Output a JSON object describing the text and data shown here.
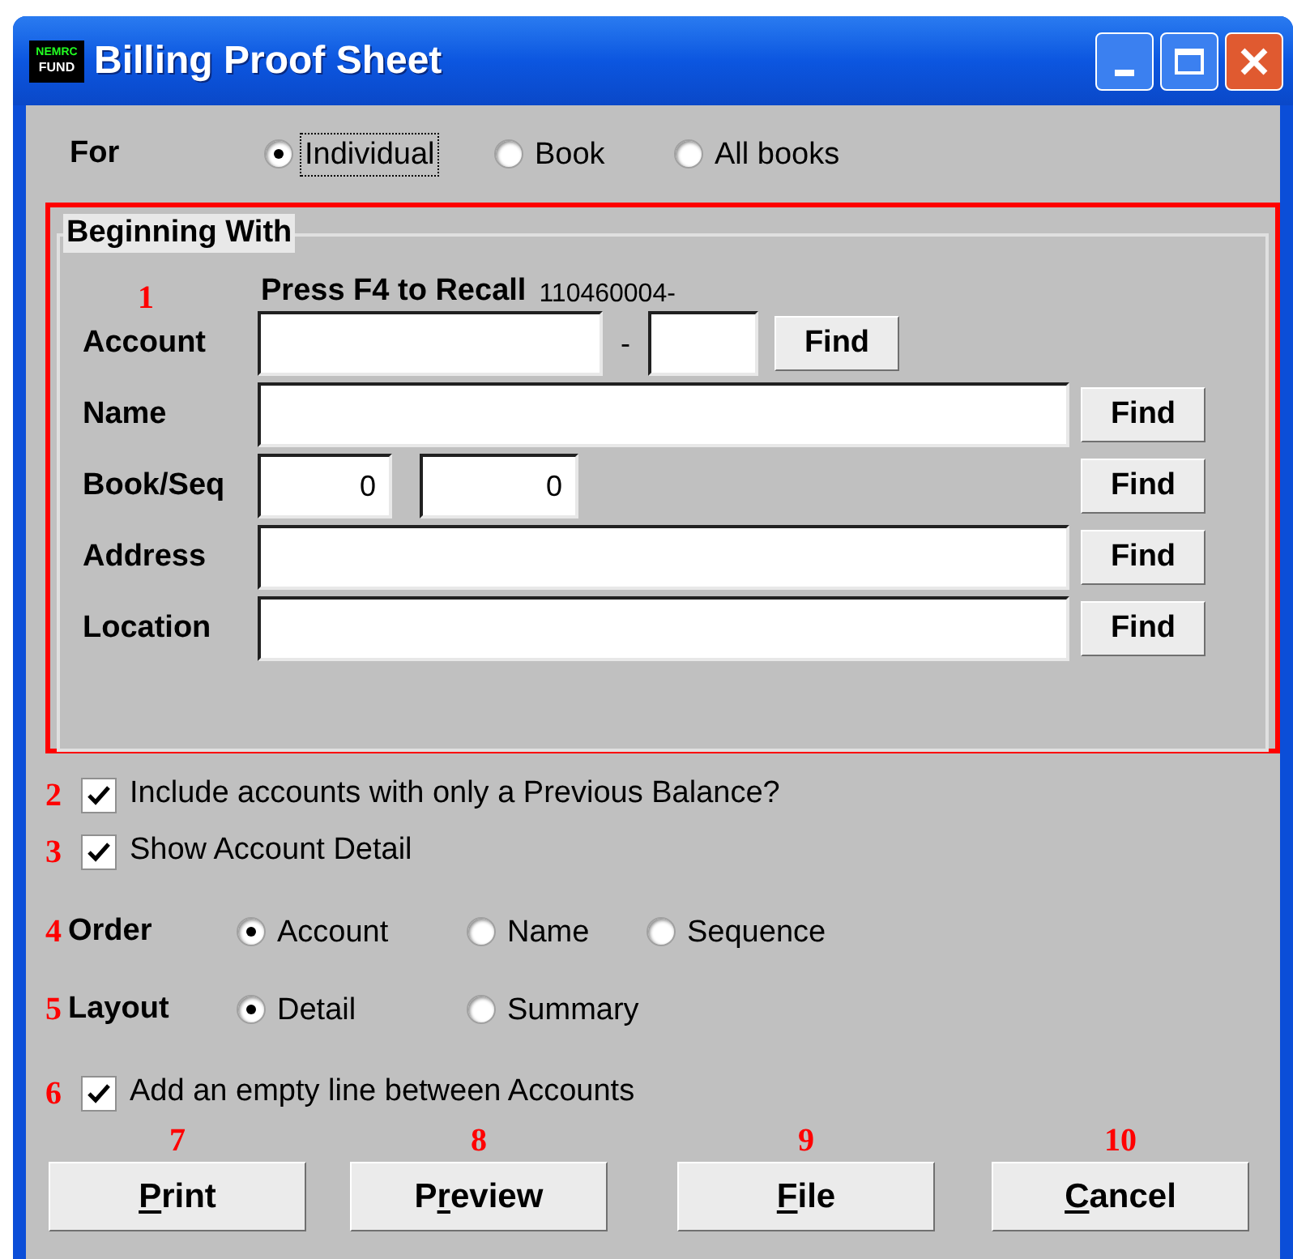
{
  "window": {
    "title": "Billing Proof Sheet",
    "icon_text": [
      "NEMRC",
      "FUND"
    ]
  },
  "for": {
    "label": "For",
    "options": [
      {
        "label": "Individual",
        "selected": true,
        "focused": true
      },
      {
        "label": "Book",
        "selected": false,
        "focused": false
      },
      {
        "label": "All books",
        "selected": false,
        "focused": false
      }
    ]
  },
  "beginning_with": {
    "title": "Beginning With",
    "callout": "1",
    "recall_label": "Press F4 to Recall",
    "recall_value": "110460004-",
    "rows": [
      {
        "kind": "account",
        "label": "Account",
        "separator": "-",
        "find": "Find"
      },
      {
        "kind": "text",
        "label": "Name",
        "find": "Find"
      },
      {
        "kind": "pair",
        "label": "Book/Seq",
        "values": [
          "0",
          "0"
        ],
        "find": "Find"
      },
      {
        "kind": "text",
        "label": "Address",
        "find": "Find"
      },
      {
        "kind": "text",
        "label": "Location",
        "find": "Find"
      }
    ]
  },
  "checkboxes": [
    {
      "callout": "2",
      "label": "Include accounts with only a Previous Balance?",
      "checked": true
    },
    {
      "callout": "3",
      "label": "Show Account Detail",
      "checked": true
    }
  ],
  "order": {
    "callout": "4",
    "label": "Order",
    "options": [
      {
        "label": "Account",
        "selected": true
      },
      {
        "label": "Name",
        "selected": false
      },
      {
        "label": "Sequence",
        "selected": false
      }
    ]
  },
  "layout": {
    "callout": "5",
    "label": "Layout",
    "options": [
      {
        "label": "Detail",
        "selected": true
      },
      {
        "label": "Summary",
        "selected": false
      }
    ]
  },
  "empty_line": {
    "callout": "6",
    "label": "Add an empty line between Accounts",
    "checked": true
  },
  "buttons": [
    {
      "callout": "7",
      "key": "P",
      "post": "rint"
    },
    {
      "callout": "8",
      "pre": "P",
      "key": "r",
      "post": "eview"
    },
    {
      "callout": "9",
      "key": "F",
      "post": "ile"
    },
    {
      "callout": "10",
      "key": "C",
      "post": "ancel"
    }
  ]
}
